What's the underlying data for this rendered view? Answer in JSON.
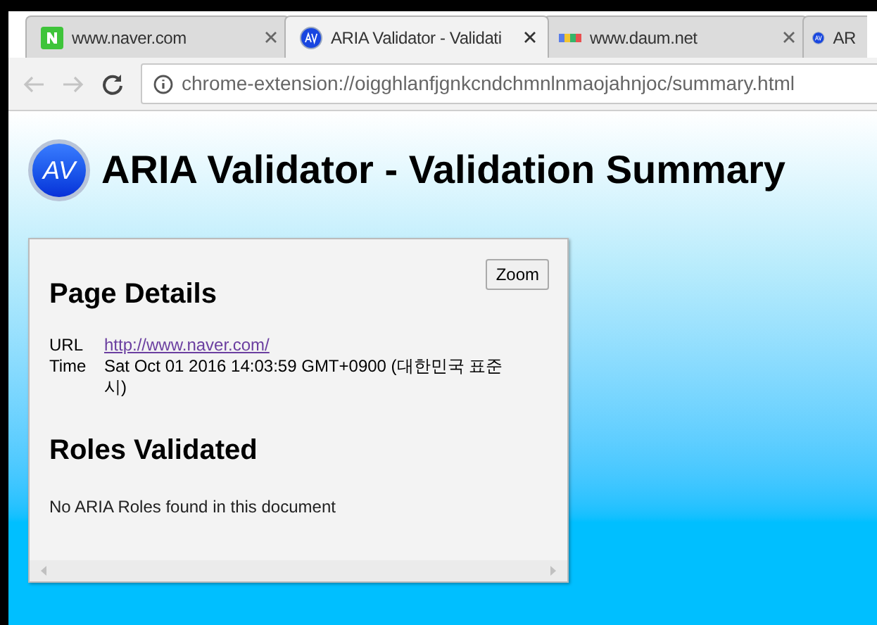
{
  "tabs": [
    {
      "kind": "n-logo",
      "label": "www.naver.com",
      "selected": false
    },
    {
      "kind": "av-logo",
      "label": "ARIA Validator - Validati",
      "selected": true
    },
    {
      "kind": "color-bars",
      "label": "www.daum.net",
      "selected": false
    },
    {
      "kind": "av-logo",
      "label": "AR",
      "selected": false
    }
  ],
  "address_bar": {
    "url": "chrome-extension://oigghlanfjgnkcndchmnlnmaojahnjoc/summary.html"
  },
  "page": {
    "logo": "AV",
    "title": "ARIA Validator - Validation Summary",
    "zoom_button": "Zoom",
    "page_details": {
      "heading": "Page Details",
      "rows": [
        {
          "label": "URL",
          "value": "http://www.naver.com/",
          "kind": "link"
        },
        {
          "label": "Time",
          "value": "Sat Oct 01 2016 14:03:59 GMT+0900 (대한민국 표준 시)",
          "kind": "text"
        }
      ]
    },
    "roles": {
      "heading": "Roles Validated",
      "message": "No ARIA Roles found in this document"
    }
  }
}
